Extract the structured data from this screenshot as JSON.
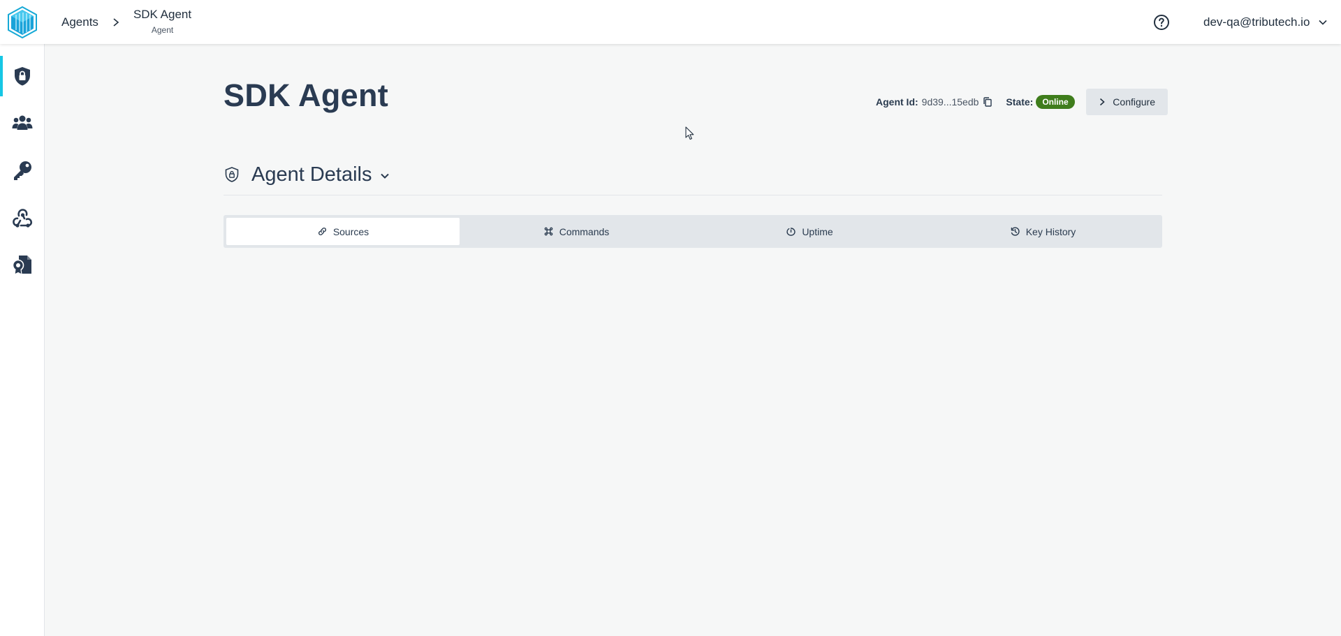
{
  "header": {
    "logo_icon": "tributech-logo-icon",
    "breadcrumb": {
      "parent_label": "Agents",
      "current_title": "SDK Agent",
      "current_subtitle": "Agent"
    },
    "help_icon": "help-circle-icon",
    "user_email": "dev-qa@tributech.io"
  },
  "sidebar": {
    "active_index": 0,
    "accent_color": "#16c7e5",
    "items": [
      {
        "icon": "shield-lock-icon"
      },
      {
        "icon": "users-icon"
      },
      {
        "icon": "key-icon"
      },
      {
        "icon": "webhook-icon"
      },
      {
        "icon": "certificate-file-icon"
      }
    ]
  },
  "main": {
    "title": "SDK Agent",
    "agent_id_label": "Agent Id:",
    "agent_id_value": "9d39...15edb",
    "state_label": "State:",
    "state_value": "Online",
    "state_color": "#3f7d1c",
    "configure_label": "Configure",
    "section_title": "Agent Details",
    "tabs": [
      {
        "label": "Sources",
        "icon": "link-icon",
        "active": true
      },
      {
        "label": "Commands",
        "icon": "command-icon",
        "active": false
      },
      {
        "label": "Uptime",
        "icon": "power-icon",
        "active": false
      },
      {
        "label": "Key History",
        "icon": "history-icon",
        "active": false
      }
    ]
  }
}
